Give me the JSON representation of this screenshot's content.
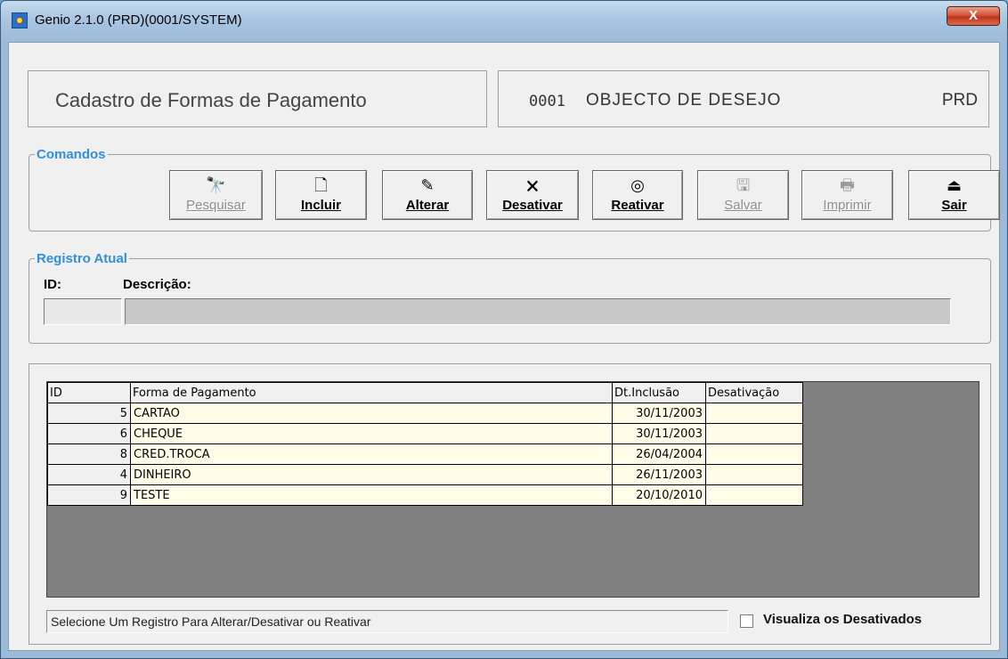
{
  "window": {
    "title": "Genio 2.1.0 (PRD)(0001/SYSTEM)",
    "close_label": "X"
  },
  "header": {
    "screen_title": "Cadastro de Formas de Pagamento",
    "company_code": "0001",
    "company_name": "OBJECTO DE DESEJO",
    "environment": "PRD"
  },
  "commands": {
    "legend": "Comandos",
    "buttons": [
      {
        "label": "Pesquisar",
        "icon": "binoculars-icon",
        "glyph": "🔭",
        "enabled": false
      },
      {
        "label": "Incluir",
        "icon": "new-document-icon",
        "glyph": "🗋",
        "enabled": true
      },
      {
        "label": "Alterar",
        "icon": "pencil-icon",
        "glyph": "✎",
        "enabled": true
      },
      {
        "label": "Desativar",
        "icon": "delete-document-icon",
        "glyph": "🗙",
        "enabled": true
      },
      {
        "label": "Reativar",
        "icon": "reactivate-icon",
        "glyph": "◎",
        "enabled": true
      },
      {
        "label": "Salvar",
        "icon": "save-icon",
        "glyph": "🖫",
        "enabled": false
      },
      {
        "label": "Imprimir",
        "icon": "printer-icon",
        "glyph": "🖶",
        "enabled": false
      },
      {
        "label": "Sair",
        "icon": "exit-icon",
        "glyph": "⏏",
        "enabled": true
      }
    ]
  },
  "record": {
    "legend": "Registro Atual",
    "id_label": "ID:",
    "description_label": "Descrição:",
    "id_value": "",
    "description_value": ""
  },
  "grid": {
    "columns": [
      "ID",
      "Forma de Pagamento",
      "Dt.Inclusão",
      "Desativação"
    ],
    "rows": [
      {
        "id": "5",
        "forma": "CARTAO",
        "inclusao": "30/11/2003",
        "desativacao": ""
      },
      {
        "id": "6",
        "forma": "CHEQUE",
        "inclusao": "30/11/2003",
        "desativacao": ""
      },
      {
        "id": "8",
        "forma": "CRED.TROCA",
        "inclusao": "26/04/2004",
        "desativacao": ""
      },
      {
        "id": "4",
        "forma": "DINHEIRO",
        "inclusao": "26/11/2003",
        "desativacao": ""
      },
      {
        "id": "9",
        "forma": "TESTE",
        "inclusao": "20/10/2010",
        "desativacao": ""
      }
    ]
  },
  "status": {
    "message": "Selecione Um Registro Para Alterar/Desativar ou Reativar",
    "show_deactivated_label": "Visualiza os Desativados",
    "show_deactivated_checked": false
  },
  "colors": {
    "legend_blue": "#2f8fe0",
    "grid_row_bg": "#fffde8",
    "grid_empty_bg": "#808080",
    "close_button_red": "#c0341a"
  }
}
